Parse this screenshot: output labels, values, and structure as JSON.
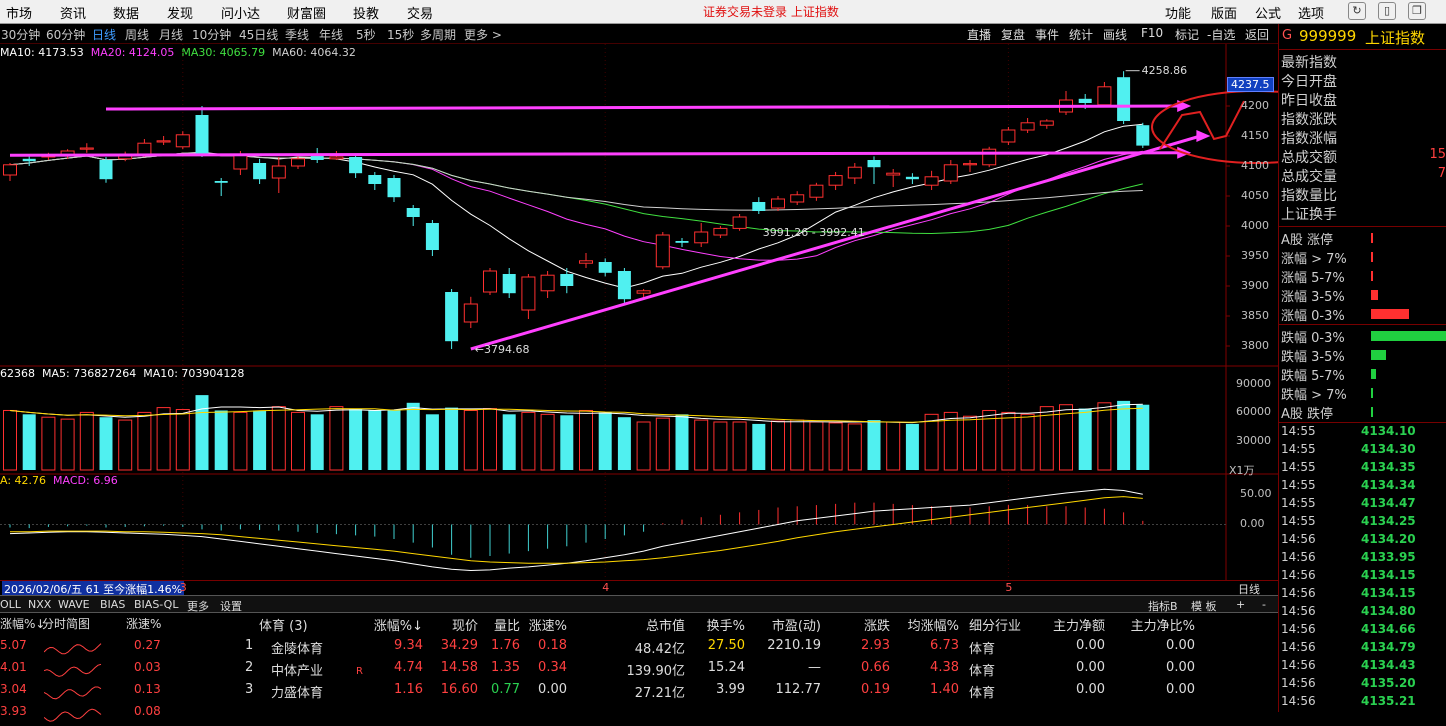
{
  "menubar": {
    "items": [
      "市场",
      "资讯",
      "数据",
      "发现",
      "问小达",
      "财富圈",
      "投教",
      "交易"
    ],
    "notice": "证券交易未登录  上证指数",
    "right_items": [
      "功能",
      "版面",
      "公式",
      "选项"
    ]
  },
  "periods": [
    {
      "label": "30分钟",
      "active": false
    },
    {
      "label": "60分钟",
      "active": false
    },
    {
      "label": "日线",
      "active": true
    },
    {
      "label": "周线",
      "active": false
    },
    {
      "label": "月线",
      "active": false
    },
    {
      "label": "10分钟",
      "active": false
    },
    {
      "label": "45日线",
      "active": false
    },
    {
      "label": "季线",
      "active": false
    },
    {
      "label": "年线",
      "active": false
    },
    {
      "label": "5秒",
      "active": false
    },
    {
      "label": "15秒",
      "active": false
    },
    {
      "label": "多周期",
      "active": false
    },
    {
      "label": "更多 >",
      "active": false
    }
  ],
  "tools": [
    "直播",
    "复盘",
    "事件",
    "统计",
    "画线",
    "F10",
    "标记",
    "-自选",
    "返回"
  ],
  "ma_legend": {
    "ma10": "MA10: 4173.53",
    "ma20": "MA20: 4124.05",
    "ma30": "MA30: 4065.79",
    "ma60": "MA60: 4064.32",
    "c10": "#ffffff",
    "c20": "#ff40ff",
    "c30": "#40e040",
    "c60": "#d0d0d0"
  },
  "chart_data": {
    "type": "candlestick",
    "ylim": [
      3770,
      4270
    ],
    "yticks": [
      3800,
      3850,
      3900,
      3950,
      4000,
      4050,
      4100,
      4150,
      4200
    ],
    "last_price_tag": "4237.5",
    "high_label": "4258.86",
    "low_label": "3794.68",
    "mid_label": "3991.26 - 3992.41",
    "up_color": "#ff3030",
    "down_color": "#50f0f0",
    "candles": [
      {
        "o": 4085,
        "c": 4102,
        "h": 4105,
        "l": 4075
      },
      {
        "o": 4112,
        "c": 4108,
        "h": 4120,
        "l": 4100
      },
      {
        "o": 4115,
        "c": 4118,
        "h": 4122,
        "l": 4110
      },
      {
        "o": 4118,
        "c": 4125,
        "h": 4128,
        "l": 4112
      },
      {
        "o": 4128,
        "c": 4130,
        "h": 4138,
        "l": 4122
      },
      {
        "o": 4110,
        "c": 4078,
        "h": 4115,
        "l": 4072
      },
      {
        "o": 4112,
        "c": 4118,
        "h": 4124,
        "l": 4108
      },
      {
        "o": 4120,
        "c": 4138,
        "h": 4145,
        "l": 4115
      },
      {
        "o": 4140,
        "c": 4142,
        "h": 4150,
        "l": 4135
      },
      {
        "o": 4132,
        "c": 4152,
        "h": 4158,
        "l": 4128
      },
      {
        "o": 4185,
        "c": 4120,
        "h": 4200,
        "l": 4115
      },
      {
        "o": 4075,
        "c": 4072,
        "h": 4080,
        "l": 4050
      },
      {
        "o": 4095,
        "c": 4118,
        "h": 4125,
        "l": 4085
      },
      {
        "o": 4105,
        "c": 4078,
        "h": 4112,
        "l": 4070
      },
      {
        "o": 4080,
        "c": 4100,
        "h": 4115,
        "l": 4055
      },
      {
        "o": 4100,
        "c": 4112,
        "h": 4118,
        "l": 4095
      },
      {
        "o": 4118,
        "c": 4110,
        "h": 4130,
        "l": 4105
      },
      {
        "o": 4112,
        "c": 4115,
        "h": 4125,
        "l": 4110
      },
      {
        "o": 4115,
        "c": 4088,
        "h": 4120,
        "l": 4080
      },
      {
        "o": 4085,
        "c": 4070,
        "h": 4090,
        "l": 4060
      },
      {
        "o": 4080,
        "c": 4048,
        "h": 4085,
        "l": 4040
      },
      {
        "o": 4030,
        "c": 4015,
        "h": 4035,
        "l": 4000
      },
      {
        "o": 4005,
        "c": 3960,
        "h": 4010,
        "l": 3950
      },
      {
        "o": 3890,
        "c": 3808,
        "h": 3895,
        "l": 3795
      },
      {
        "o": 3840,
        "c": 3870,
        "h": 3882,
        "l": 3830
      },
      {
        "o": 3890,
        "c": 3925,
        "h": 3930,
        "l": 3885
      },
      {
        "o": 3920,
        "c": 3888,
        "h": 3930,
        "l": 3880
      },
      {
        "o": 3860,
        "c": 3915,
        "h": 3920,
        "l": 3845
      },
      {
        "o": 3892,
        "c": 3918,
        "h": 3925,
        "l": 3880
      },
      {
        "o": 3920,
        "c": 3900,
        "h": 3930,
        "l": 3888
      },
      {
        "o": 3938,
        "c": 3942,
        "h": 3955,
        "l": 3930
      },
      {
        "o": 3940,
        "c": 3922,
        "h": 3946,
        "l": 3916
      },
      {
        "o": 3925,
        "c": 3878,
        "h": 3930,
        "l": 3870
      },
      {
        "o": 3888,
        "c": 3892,
        "h": 3895,
        "l": 3880
      },
      {
        "o": 3932,
        "c": 3985,
        "h": 3990,
        "l": 3928
      },
      {
        "o": 3975,
        "c": 3972,
        "h": 3980,
        "l": 3965
      },
      {
        "o": 3972,
        "c": 3990,
        "h": 4005,
        "l": 3965
      },
      {
        "o": 3985,
        "c": 3996,
        "h": 4000,
        "l": 3980
      },
      {
        "o": 3996,
        "c": 4015,
        "h": 4020,
        "l": 3992
      },
      {
        "o": 4040,
        "c": 4025,
        "h": 4048,
        "l": 4020
      },
      {
        "o": 4030,
        "c": 4045,
        "h": 4050,
        "l": 4025
      },
      {
        "o": 4040,
        "c": 4052,
        "h": 4058,
        "l": 4035
      },
      {
        "o": 4048,
        "c": 4068,
        "h": 4072,
        "l": 4042
      },
      {
        "o": 4068,
        "c": 4084,
        "h": 4090,
        "l": 4060
      },
      {
        "o": 4080,
        "c": 4098,
        "h": 4105,
        "l": 4070
      },
      {
        "o": 4110,
        "c": 4098,
        "h": 4116,
        "l": 4070
      },
      {
        "o": 4085,
        "c": 4088,
        "h": 4095,
        "l": 4065
      },
      {
        "o": 4082,
        "c": 4078,
        "h": 4088,
        "l": 4070
      },
      {
        "o": 4068,
        "c": 4082,
        "h": 4092,
        "l": 4060
      },
      {
        "o": 4075,
        "c": 4102,
        "h": 4110,
        "l": 4070
      },
      {
        "o": 4102,
        "c": 4104,
        "h": 4110,
        "l": 4090
      },
      {
        "o": 4102,
        "c": 4128,
        "h": 4132,
        "l": 4098
      },
      {
        "o": 4140,
        "c": 4160,
        "h": 4165,
        "l": 4135
      },
      {
        "o": 4160,
        "c": 4172,
        "h": 4180,
        "l": 4155
      },
      {
        "o": 4168,
        "c": 4175,
        "h": 4178,
        "l": 4162
      },
      {
        "o": 4190,
        "c": 4210,
        "h": 4225,
        "l": 4185
      },
      {
        "o": 4212,
        "c": 4205,
        "h": 4220,
        "l": 4195
      },
      {
        "o": 4202,
        "c": 4232,
        "h": 4240,
        "l": 4198
      },
      {
        "o": 4248,
        "c": 4175,
        "h": 4258,
        "l": 4170
      },
      {
        "o": 4168,
        "c": 4134,
        "h": 4172,
        "l": 4130
      }
    ],
    "volume": {
      "legend_total": "62368",
      "legend_ma5": "MA5: 736827264",
      "legend_ma10": "MA10: 703904128",
      "yticks": [
        30000,
        60000,
        90000
      ],
      "ylim": [
        0,
        100000
      ],
      "unit": "X1万",
      "values": [
        62000,
        58000,
        55000,
        53000,
        60000,
        55000,
        52000,
        60000,
        65000,
        63000,
        78000,
        62000,
        60000,
        62000,
        66000,
        60000,
        58000,
        66000,
        64000,
        62000,
        63000,
        70000,
        58000,
        65000,
        62000,
        64000,
        58000,
        60000,
        58000,
        57000,
        62000,
        60000,
        55000,
        50000,
        54000,
        58000,
        52000,
        50000,
        50000,
        48000,
        51000,
        52000,
        50000,
        49000,
        48000,
        52000,
        50000,
        48000,
        58000,
        60000,
        56000,
        62000,
        60000,
        58000,
        66000,
        68000,
        64000,
        70000,
        72000,
        68000
      ]
    },
    "macd": {
      "legend_dea": "A: 42.76",
      "legend_macd": "MACD: 6.96",
      "yticks": [
        0,
        50
      ],
      "ylim": [
        -90,
        80
      ],
      "bars": [
        -5,
        -6,
        -4,
        -3,
        -2,
        -5,
        -4,
        -3,
        -2,
        -4,
        -8,
        -10,
        -8,
        -9,
        -10,
        -12,
        -14,
        -16,
        -18,
        -20,
        -24,
        -30,
        -38,
        -50,
        -55,
        -52,
        -48,
        -44,
        -40,
        -36,
        -30,
        -24,
        -18,
        -12,
        2,
        8,
        12,
        16,
        20,
        24,
        28,
        30,
        32,
        34,
        36,
        36,
        34,
        32,
        30,
        30,
        28,
        30,
        32,
        32,
        30,
        30,
        28,
        26,
        20,
        6
      ],
      "dif": [
        -15,
        -14,
        -13,
        -12,
        -12,
        -13,
        -14,
        -15,
        -16,
        -18,
        -20,
        -24,
        -28,
        -32,
        -36,
        -40,
        -44,
        -48,
        -52,
        -56,
        -60,
        -65,
        -70,
        -74,
        -76,
        -75,
        -72,
        -70,
        -67,
        -64,
        -60,
        -55,
        -50,
        -44,
        -36,
        -30,
        -24,
        -18,
        -12,
        -6,
        0,
        6,
        10,
        14,
        18,
        22,
        24,
        26,
        28,
        30,
        32,
        36,
        40,
        44,
        48,
        52,
        55,
        58,
        56,
        50
      ],
      "dea": [
        -12,
        -12,
        -11,
        -11,
        -11,
        -11,
        -12,
        -12,
        -13,
        -14,
        -15,
        -17,
        -20,
        -23,
        -26,
        -29,
        -32,
        -35,
        -38,
        -41,
        -44,
        -48,
        -52,
        -56,
        -60,
        -62,
        -63,
        -64,
        -64,
        -64,
        -63,
        -62,
        -60,
        -58,
        -55,
        -51,
        -47,
        -43,
        -38,
        -33,
        -28,
        -22,
        -17,
        -12,
        -8,
        -4,
        0,
        4,
        8,
        12,
        16,
        20,
        24,
        28,
        32,
        36,
        40,
        44,
        46,
        43
      ]
    },
    "trend_lines": [
      {
        "name": "upper-horizontal",
        "from": [
          5,
          4195
        ],
        "to": [
          61,
          4200
        ]
      },
      {
        "name": "lower-horizontal",
        "from": [
          0,
          4118
        ],
        "to": [
          61,
          4122
        ]
      },
      {
        "name": "rising-support",
        "from": [
          24,
          3795
        ],
        "to": [
          62,
          4150
        ]
      }
    ],
    "date_labels": [
      {
        "i": 9,
        "text": "3"
      },
      {
        "i": 31,
        "text": "4"
      },
      {
        "i": 52,
        "text": "5"
      }
    ],
    "date_info": "2026/02/06/五 61 至今涨幅1.46%",
    "period_tag": "日线"
  },
  "subtabs": [
    "OLL",
    "NXX",
    "WAVE",
    "BIAS",
    "BIAS-QL",
    "更多",
    "设置"
  ],
  "subtabs_right": [
    "指标B",
    "模 板",
    "+",
    "-"
  ],
  "leftpanel": {
    "headers": [
      "涨幅%↓",
      "分时简图",
      "涨速%"
    ],
    "rows": [
      {
        "chg": "5.07",
        "speed": "0.27"
      },
      {
        "chg": "4.01",
        "speed": "0.03"
      },
      {
        "chg": "3.04",
        "speed": "0.13"
      },
      {
        "chg": "3.93",
        "speed": "0.08"
      }
    ]
  },
  "stock_table": {
    "sector": "体育 (3)",
    "headers": [
      "涨幅%↓",
      "现价",
      "量比",
      "涨速%",
      "总市值",
      "换手%",
      "市盈(动)",
      "涨跌",
      "均涨幅%",
      "细分行业",
      "主力净额",
      "主力净比%"
    ],
    "rows": [
      {
        "n": "1",
        "name": "金陵体育",
        "tag": "",
        "chg": "9.34",
        "price": "34.29",
        "vr": "1.76",
        "spd": "0.18",
        "mcap": "48.42亿",
        "turn": "27.50",
        "pe": "2210.19",
        "diff": "2.93",
        "avg": "6.73",
        "ind": "体育",
        "net": "0.00",
        "ratio": "0.00"
      },
      {
        "n": "2",
        "name": "中体产业",
        "tag": "R",
        "chg": "4.74",
        "price": "14.58",
        "vr": "1.35",
        "spd": "0.34",
        "mcap": "139.90亿",
        "turn": "15.24",
        "pe": "—",
        "diff": "0.66",
        "avg": "4.38",
        "ind": "体育",
        "net": "0.00",
        "ratio": "0.00"
      },
      {
        "n": "3",
        "name": "力盛体育",
        "tag": "",
        "chg": "1.16",
        "price": "16.60",
        "vr": "0.77",
        "spd": "0.00",
        "mcap": "27.21亿",
        "turn": "3.99",
        "pe": "112.77",
        "diff": "0.19",
        "avg": "1.40",
        "ind": "体育",
        "net": "0.00",
        "ratio": "0.00"
      }
    ]
  },
  "rightpanel": {
    "code_prefix": "G",
    "code": "999999",
    "name": "上证指数",
    "stats": [
      "最新指数",
      "今日开盘",
      "昨日收盘",
      "指数涨跌",
      "指数涨幅",
      "总成交额",
      "总成交量",
      "指数量比",
      "上证换手"
    ],
    "stat_vals": [
      "",
      "",
      "",
      "",
      "",
      "15",
      "7",
      "",
      ""
    ],
    "up_stats": [
      {
        "label": "A股 涨停",
        "bar": 0.02
      },
      {
        "label": "涨幅 > 7%",
        "bar": 0.03
      },
      {
        "label": "涨幅 5-7%",
        "bar": 0.03
      },
      {
        "label": "涨幅 3-5%",
        "bar": 0.09
      },
      {
        "label": "涨幅 0-3%",
        "bar": 0.5
      }
    ],
    "down_stats": [
      {
        "label": "跌幅 0-3%",
        "bar": 1.0
      },
      {
        "label": "跌幅 3-5%",
        "bar": 0.2
      },
      {
        "label": "跌幅 5-7%",
        "bar": 0.06
      },
      {
        "label": "跌幅 > 7%",
        "bar": 0.03
      },
      {
        "label": "A股 跌停",
        "bar": 0.01
      }
    ],
    "ticks": [
      {
        "t": "14:55",
        "p": "4134.10"
      },
      {
        "t": "14:55",
        "p": "4134.30"
      },
      {
        "t": "14:55",
        "p": "4134.35"
      },
      {
        "t": "14:55",
        "p": "4134.34"
      },
      {
        "t": "14:55",
        "p": "4134.47"
      },
      {
        "t": "14:55",
        "p": "4134.25"
      },
      {
        "t": "14:56",
        "p": "4134.20"
      },
      {
        "t": "14:56",
        "p": "4133.95"
      },
      {
        "t": "14:56",
        "p": "4134.15"
      },
      {
        "t": "14:56",
        "p": "4134.15"
      },
      {
        "t": "14:56",
        "p": "4134.80"
      },
      {
        "t": "14:56",
        "p": "4134.66"
      },
      {
        "t": "14:56",
        "p": "4134.79"
      },
      {
        "t": "14:56",
        "p": "4134.43"
      },
      {
        "t": "14:56",
        "p": "4135.20"
      },
      {
        "t": "14:56",
        "p": "4135.21"
      }
    ]
  }
}
